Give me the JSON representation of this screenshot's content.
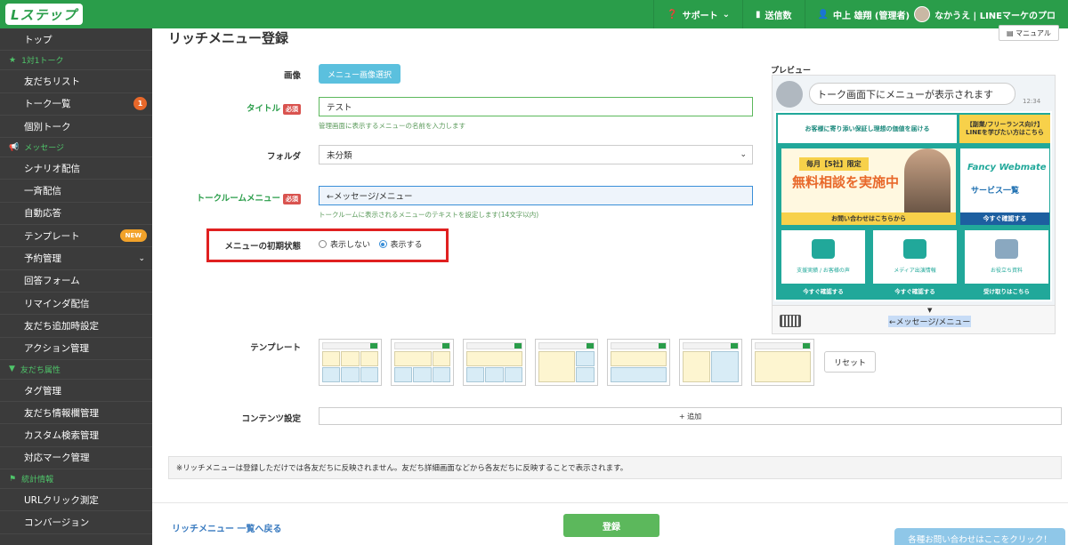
{
  "header": {
    "logo": "Lステップ",
    "support": "サポート",
    "sent_count": "送信数",
    "user": "中上 雄翔 (管理者)",
    "account": "なかうえ | LINEマーケのプロ"
  },
  "sidebar": {
    "items": [
      {
        "type": "item",
        "label": "トップ"
      },
      {
        "type": "section",
        "label": "1対1トーク"
      },
      {
        "type": "item",
        "label": "友だちリスト"
      },
      {
        "type": "item",
        "label": "トーク一覧",
        "badge": "1"
      },
      {
        "type": "item",
        "label": "個別トーク"
      },
      {
        "type": "section",
        "label": "メッセージ"
      },
      {
        "type": "item",
        "label": "シナリオ配信"
      },
      {
        "type": "item",
        "label": "一斉配信"
      },
      {
        "type": "item",
        "label": "自動応答"
      },
      {
        "type": "item",
        "label": "テンプレート",
        "new": "NEW"
      },
      {
        "type": "item",
        "label": "予約管理",
        "chevron": true
      },
      {
        "type": "item",
        "label": "回答フォーム"
      },
      {
        "type": "item",
        "label": "リマインダ配信"
      },
      {
        "type": "item",
        "label": "友だち追加時設定"
      },
      {
        "type": "item",
        "label": "アクション管理"
      },
      {
        "type": "section",
        "label": "友だち属性"
      },
      {
        "type": "item",
        "label": "タグ管理"
      },
      {
        "type": "item",
        "label": "友だち情報欄管理"
      },
      {
        "type": "item",
        "label": "カスタム検索管理"
      },
      {
        "type": "item",
        "label": "対応マーク管理"
      },
      {
        "type": "section",
        "label": "統計情報"
      },
      {
        "type": "item",
        "label": "URLクリック測定"
      },
      {
        "type": "item",
        "label": "コンバージョン"
      }
    ]
  },
  "main": {
    "title": "リッチメニュー登録",
    "manual": "マニュアル",
    "image_label": "画像",
    "image_button": "メニュー画像選択",
    "title_label": "タイトル",
    "required": "必須",
    "title_value": "テスト",
    "title_hint": "管理画面に表示するメニューの名前を入力します",
    "folder_label": "フォルダ",
    "folder_value": "未分類",
    "talkroom_label": "トークルームメニュー",
    "talkroom_value": "←メッセージ/メニュー",
    "talkroom_hint": "トークルームに表示されるメニューのテキストを設定します(14文字以内)",
    "initial_label": "メニューの初期状態",
    "radio_hide": "表示しない",
    "radio_show": "表示する",
    "template_label": "テンプレート",
    "reset": "リセット",
    "content_label": "コンテンツ設定",
    "add": "+ 追加",
    "note": "※リッチメニューは登録しただけでは各友だちに反映されません。友だち詳細画面などから各友だちに反映することで表示されます。",
    "back_link": "リッチメニュー 一覧へ戻る",
    "submit": "登録",
    "help": "各種お問い合わせはここをクリック！"
  },
  "preview": {
    "label": "プレビュー",
    "bubble": "トーク画面下にメニューが表示されます",
    "time": "12:34",
    "rich_top": "お客様に寄り添い保証し理想の価値を届ける",
    "promo_line1": "【副業/フリーランス向け】",
    "promo_line2": "LINEを学びたい方はこちら",
    "c1_tag": "毎月【5社】限定",
    "c1_title": "無料相談を実施中",
    "c1_button": "お問い合わせはこちらから",
    "c2_logo": "Fancy Webmate",
    "c2_title": "サービス一覧",
    "c2_button": "今すぐ確認する",
    "b1_label": "支援実績 / お客様の声",
    "b1_button": "今すぐ確認する",
    "b2_label": "メディア出演情報",
    "b2_button": "今すぐ確認する",
    "b3_label": "お役立ち資料",
    "b3_button": "受け取りはこちら",
    "menu_text": "←メッセージ/メニュー"
  },
  "colors": {
    "brand_green": "#2a9d4a",
    "sidebar_bg": "#3b3b3b",
    "highlight_red": "#e02020",
    "rich_teal": "#21a89a"
  }
}
